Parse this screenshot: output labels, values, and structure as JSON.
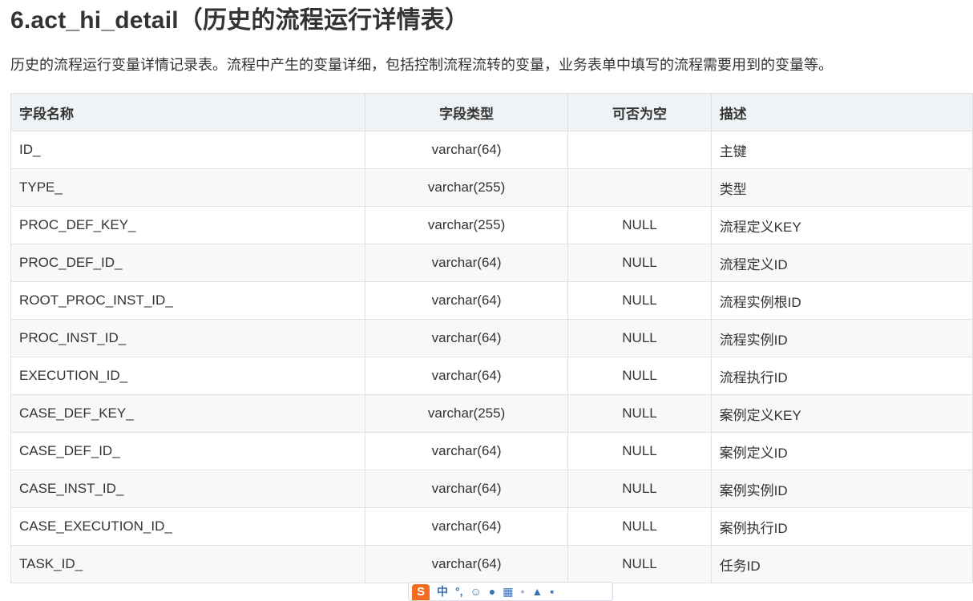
{
  "heading": {
    "title": "6.act_hi_detail（历史的流程运行详情表）",
    "description": "历史的流程运行变量详情记录表。流程中产生的变量详细，包括控制流程流转的变量，业务表单中填写的流程需要用到的变量等。"
  },
  "table": {
    "headers": [
      "字段名称",
      "字段类型",
      "可否为空",
      "描述"
    ],
    "rows": [
      [
        "ID_",
        "varchar(64)",
        "",
        "主键"
      ],
      [
        "TYPE_",
        "varchar(255)",
        "",
        "类型"
      ],
      [
        "PROC_DEF_KEY_",
        "varchar(255)",
        "NULL",
        "流程定义KEY"
      ],
      [
        "PROC_DEF_ID_",
        "varchar(64)",
        "NULL",
        "流程定义ID"
      ],
      [
        "ROOT_PROC_INST_ID_",
        "varchar(64)",
        "NULL",
        "流程实例根ID"
      ],
      [
        "PROC_INST_ID_",
        "varchar(64)",
        "NULL",
        "流程实例ID"
      ],
      [
        "EXECUTION_ID_",
        "varchar(64)",
        "NULL",
        "流程执行ID"
      ],
      [
        "CASE_DEF_KEY_",
        "varchar(255)",
        "NULL",
        "案例定义KEY"
      ],
      [
        "CASE_DEF_ID_",
        "varchar(64)",
        "NULL",
        "案例定义ID"
      ],
      [
        "CASE_INST_ID_",
        "varchar(64)",
        "NULL",
        "案例实例ID"
      ],
      [
        "CASE_EXECUTION_ID_",
        "varchar(64)",
        "NULL",
        "案例执行ID"
      ],
      [
        "TASK_ID_",
        "varchar(64)",
        "NULL",
        "任务ID"
      ]
    ]
  },
  "ime_toolbar": {
    "logo": "S",
    "mode_label": "中",
    "icons": [
      "punctuation-icon",
      "emoji-icon",
      "microphone-icon",
      "keyboard-icon",
      "dot-icon",
      "shirt-icon",
      "grid-icon"
    ]
  },
  "colors": {
    "header_bg": "#eff3f5",
    "stripe_bg": "#f8f8f8",
    "border": "#dfe2e5",
    "text": "#333333",
    "ime_logo": "#f46a1e",
    "ime_icon": "#3b6fb6"
  }
}
